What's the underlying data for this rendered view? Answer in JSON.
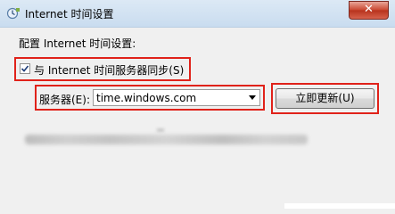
{
  "window": {
    "title": "Internet 时间设置",
    "close_label": "✕"
  },
  "panel": {
    "section_label": "配置 Internet 时间设置:",
    "sync_checkbox": {
      "label": "与 Internet 时间服务器同步(S)",
      "checked": true
    },
    "server": {
      "label": "服务器(E):",
      "value": "time.windows.com"
    },
    "update_button": {
      "label": "立即更新(U)"
    }
  },
  "colors": {
    "highlight": "#e0221a",
    "close": "#c9452f"
  }
}
